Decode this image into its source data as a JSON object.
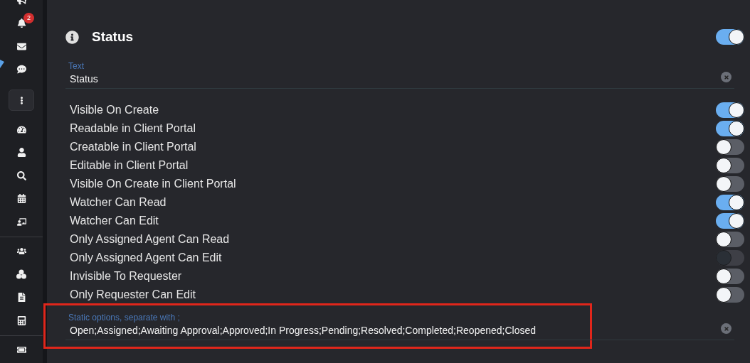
{
  "sidebar": {
    "notification_badge": "2",
    "items": [
      {
        "kind": "bullhorn"
      },
      {
        "kind": "bell"
      },
      {
        "kind": "envelope"
      },
      {
        "kind": "comment"
      },
      {
        "kind": "more"
      },
      {
        "kind": "gauge"
      },
      {
        "kind": "user"
      },
      {
        "kind": "search"
      },
      {
        "kind": "calendar"
      },
      {
        "kind": "teacher"
      },
      {
        "kind": "divider"
      },
      {
        "kind": "users"
      },
      {
        "kind": "circles"
      },
      {
        "kind": "file"
      },
      {
        "kind": "calculator"
      },
      {
        "kind": "divider"
      },
      {
        "kind": "ticket"
      }
    ]
  },
  "section": {
    "title": "Status",
    "enabled": true
  },
  "text_field": {
    "label": "Text",
    "value": "Status"
  },
  "options": [
    {
      "label": "Visible On Create",
      "on": true,
      "disabled": false
    },
    {
      "label": "Readable in Client Portal",
      "on": true,
      "disabled": false
    },
    {
      "label": "Creatable in Client Portal",
      "on": false,
      "disabled": false
    },
    {
      "label": "Editable in Client Portal",
      "on": false,
      "disabled": false
    },
    {
      "label": "Visible On Create in Client Portal",
      "on": false,
      "disabled": false
    },
    {
      "label": "Watcher Can Read",
      "on": true,
      "disabled": false
    },
    {
      "label": "Watcher Can Edit",
      "on": true,
      "disabled": false
    },
    {
      "label": "Only Assigned Agent Can Read",
      "on": false,
      "disabled": false
    },
    {
      "label": "Only Assigned Agent Can Edit",
      "on": false,
      "disabled": true
    },
    {
      "label": "Invisible To Requester",
      "on": false,
      "disabled": false
    },
    {
      "label": "Only Requester Can Edit",
      "on": false,
      "disabled": false
    }
  ],
  "static_options_field": {
    "label": "Static options, separate with ;",
    "value": "Open;Assigned;Awaiting Approval;Approved;In Progress;Pending;Resolved;Completed;Reopened;Closed",
    "highlighted": true
  }
}
